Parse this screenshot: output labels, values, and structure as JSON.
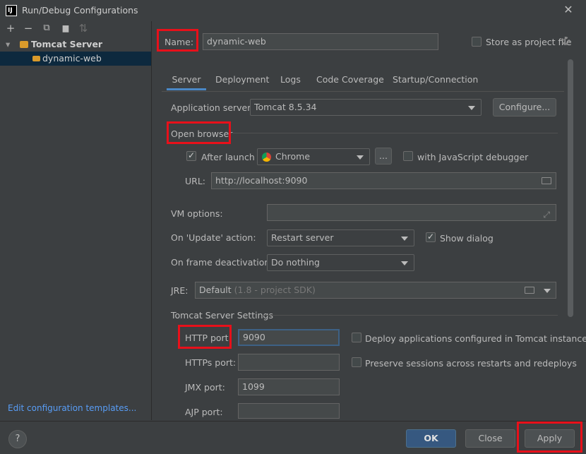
{
  "window": {
    "title": "Run/Debug Configurations",
    "close_glyph": "✕"
  },
  "toolbar": {
    "add": "+",
    "remove": "−",
    "copy": "⧉",
    "folder": "▆",
    "sort": "⇅"
  },
  "tree": {
    "group": {
      "arrow": "▾",
      "label": "Tomcat Server"
    },
    "item": {
      "label": "dynamic-web"
    }
  },
  "edit_templates_link": "Edit configuration templates...",
  "name_label": "Name:",
  "name_value": "dynamic-web",
  "store_as_project_file": "Store as project file",
  "tabs": [
    "Server",
    "Deployment",
    "Logs",
    "Code Coverage",
    "Startup/Connection"
  ],
  "app_server": {
    "label": "Application server:",
    "value": "Tomcat 8.5.34",
    "configure": "Configure..."
  },
  "open_browser": {
    "heading": "Open browser",
    "after_launch": "After launch",
    "browser": "Chrome",
    "dots": "...",
    "js_debugger": "with JavaScript debugger",
    "url_label": "URL:",
    "url_value": "http://localhost:9090"
  },
  "vm_options_label": "VM options:",
  "on_update": {
    "label": "On 'Update' action:",
    "value": "Restart server",
    "show_dialog": "Show dialog"
  },
  "on_frame": {
    "label": "On frame deactivation:",
    "value": "Do nothing"
  },
  "jre": {
    "label": "JRE:",
    "value": "Default",
    "hint": "(1.8 - project SDK)"
  },
  "tomcat_settings": {
    "heading": "Tomcat Server Settings",
    "http_label": "HTTP port:",
    "http_value": "9090",
    "https_label": "HTTPs port:",
    "jmx_label": "JMX port:",
    "jmx_value": "1099",
    "ajp_label": "AJP port:",
    "deploy_label": "Deploy applications configured in Tomcat instance",
    "preserve_label": "Preserve sessions across restarts and redeploys"
  },
  "buttons": {
    "ok": "OK",
    "close": "Close",
    "apply": "Apply",
    "help": "?"
  },
  "colors": {
    "accent": "#4a88c7",
    "highlight": "#e8101a",
    "ok_button": "#365880"
  }
}
